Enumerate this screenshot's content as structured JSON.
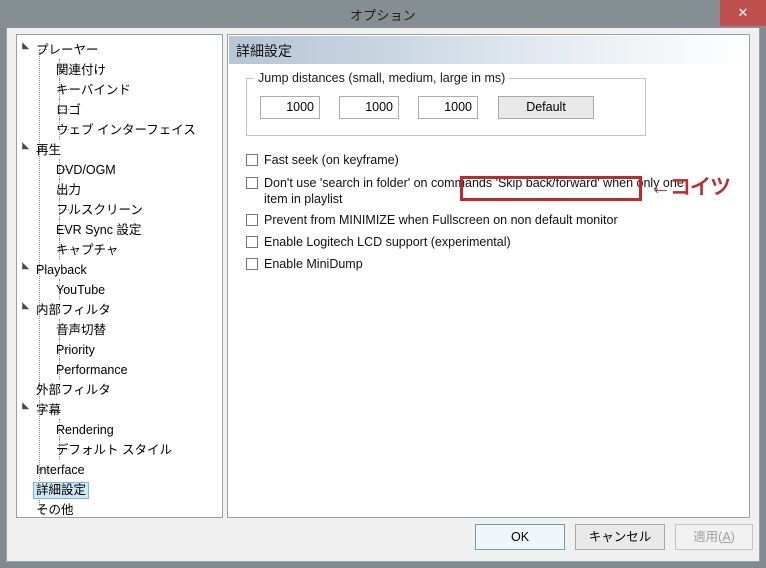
{
  "window": {
    "title": "オプション",
    "close_label": "✕",
    "accent_red": "#c0504d"
  },
  "tree": {
    "items": [
      {
        "label": "プレーヤー",
        "level": 0,
        "expander": true,
        "selected": false
      },
      {
        "label": "関連付け",
        "level": 1,
        "expander": false,
        "selected": false
      },
      {
        "label": "キーバインド",
        "level": 1,
        "expander": false,
        "selected": false
      },
      {
        "label": "ロゴ",
        "level": 1,
        "expander": false,
        "selected": false
      },
      {
        "label": "ウェブ インターフェイス",
        "level": 1,
        "expander": false,
        "selected": false
      },
      {
        "label": "再生",
        "level": 0,
        "expander": true,
        "selected": false
      },
      {
        "label": "DVD/OGM",
        "level": 1,
        "expander": false,
        "selected": false
      },
      {
        "label": "出力",
        "level": 1,
        "expander": false,
        "selected": false
      },
      {
        "label": "フルスクリーン",
        "level": 1,
        "expander": false,
        "selected": false
      },
      {
        "label": "EVR Sync 設定",
        "level": 1,
        "expander": false,
        "selected": false
      },
      {
        "label": "キャプチャ",
        "level": 1,
        "expander": false,
        "selected": false
      },
      {
        "label": "Playback",
        "level": 0,
        "expander": true,
        "selected": false
      },
      {
        "label": "YouTube",
        "level": 1,
        "expander": false,
        "selected": false
      },
      {
        "label": "内部フィルタ",
        "level": 0,
        "expander": true,
        "selected": false
      },
      {
        "label": "音声切替",
        "level": 1,
        "expander": false,
        "selected": false
      },
      {
        "label": "Priority",
        "level": 1,
        "expander": false,
        "selected": false
      },
      {
        "label": "Performance",
        "level": 1,
        "expander": false,
        "selected": false
      },
      {
        "label": "外部フィルタ",
        "level": 0,
        "expander": false,
        "selected": false
      },
      {
        "label": "字幕",
        "level": 0,
        "expander": true,
        "selected": false
      },
      {
        "label": "Rendering",
        "level": 1,
        "expander": false,
        "selected": false
      },
      {
        "label": "デフォルト スタイル",
        "level": 1,
        "expander": false,
        "selected": false
      },
      {
        "label": "Interface",
        "level": 0,
        "expander": false,
        "selected": false
      },
      {
        "label": "詳細設定",
        "level": 0,
        "expander": false,
        "selected": true
      },
      {
        "label": "その他",
        "level": 0,
        "expander": false,
        "selected": false
      }
    ],
    "selected_color": "#cce8f4",
    "selected_border": "#7bb7d6"
  },
  "panel": {
    "header": "詳細設定",
    "jump_group": {
      "title": "Jump distances (small, medium, large in ms)",
      "values": [
        "1000",
        "1000",
        "1000"
      ],
      "default_button": "Default"
    },
    "checkboxes": [
      {
        "label": "Fast seek (on keyframe)",
        "checked": false
      },
      {
        "label": "Don't use 'search in folder' on commands 'Skip back/forward' when only one item in playlist",
        "checked": false
      },
      {
        "label": "Prevent from MINIMIZE when Fullscreen on non default monitor",
        "checked": false
      },
      {
        "label": "Enable Logitech LCD support (experimental)",
        "checked": false
      },
      {
        "label": "Enable MiniDump",
        "checked": false
      }
    ]
  },
  "annotation": {
    "text": "←コイツ",
    "color": "#c1272d"
  },
  "buttons": {
    "ok": "OK",
    "cancel": "キャンセル",
    "apply_prefix": "適用(",
    "apply_key": "A",
    "apply_suffix": ")"
  }
}
